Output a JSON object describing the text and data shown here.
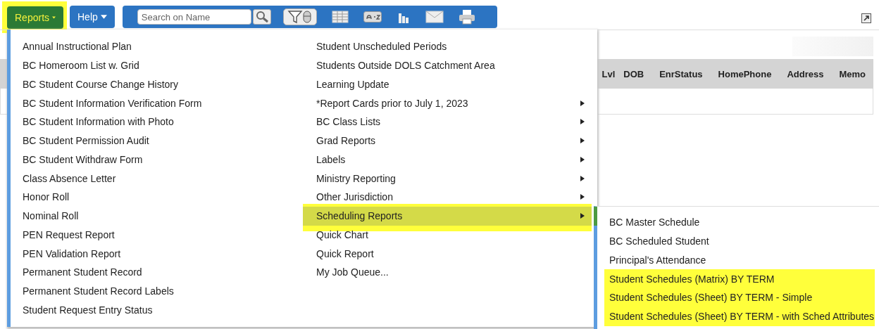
{
  "toolbar": {
    "reports_button": {
      "label": "Reports",
      "highlighted": true
    },
    "help_button": {
      "label": "Help"
    },
    "search": {
      "placeholder": "Search on Name"
    }
  },
  "table": {
    "columns": [
      "Lvl",
      "DOB",
      "EnrStatus",
      "HomePhone",
      "Address",
      "Memo"
    ]
  },
  "reports_menu": {
    "columns": [
      [
        {
          "label": "Annual Instructional Plan",
          "has_submenu": false,
          "selected": false
        },
        {
          "label": "BC Homeroom List w. Grid",
          "has_submenu": false,
          "selected": false
        },
        {
          "label": "BC Student Course Change History",
          "has_submenu": false,
          "selected": false
        },
        {
          "label": "BC Student Information Verification Form",
          "has_submenu": false,
          "selected": false
        },
        {
          "label": "BC Student Information with Photo",
          "has_submenu": false,
          "selected": false
        },
        {
          "label": "BC Student Permission Audit",
          "has_submenu": false,
          "selected": false
        },
        {
          "label": "BC Student Withdraw Form",
          "has_submenu": false,
          "selected": false
        },
        {
          "label": "Class Absence Letter",
          "has_submenu": false,
          "selected": false
        },
        {
          "label": "Honor Roll",
          "has_submenu": false,
          "selected": false
        },
        {
          "label": "Nominal Roll",
          "has_submenu": false,
          "selected": false
        },
        {
          "label": "PEN Request Report",
          "has_submenu": false,
          "selected": false
        },
        {
          "label": "PEN Validation Report",
          "has_submenu": false,
          "selected": false
        },
        {
          "label": "Permanent Student Record",
          "has_submenu": false,
          "selected": false
        },
        {
          "label": "Permanent Student Record Labels",
          "has_submenu": false,
          "selected": false
        },
        {
          "label": "Student Request Entry Status",
          "has_submenu": false,
          "selected": false
        }
      ],
      [
        {
          "label": "Student Unscheduled Periods",
          "has_submenu": false,
          "selected": false
        },
        {
          "label": "Students Outside DOLS Catchment Area",
          "has_submenu": false,
          "selected": false
        },
        {
          "label": "Learning Update",
          "has_submenu": false,
          "selected": false
        },
        {
          "label": "*Report Cards prior to July 1, 2023",
          "has_submenu": true,
          "selected": false
        },
        {
          "label": "BC Class Lists",
          "has_submenu": true,
          "selected": false
        },
        {
          "label": "Grad Reports",
          "has_submenu": true,
          "selected": false
        },
        {
          "label": "Labels",
          "has_submenu": true,
          "selected": false
        },
        {
          "label": "Ministry Reporting",
          "has_submenu": true,
          "selected": false
        },
        {
          "label": "Other Jurisdiction",
          "has_submenu": true,
          "selected": false
        },
        {
          "label": "Scheduling Reports",
          "has_submenu": true,
          "selected": true
        },
        {
          "label": "Quick Chart",
          "has_submenu": false,
          "selected": false
        },
        {
          "label": "Quick Report",
          "has_submenu": false,
          "selected": false
        },
        {
          "label": "My Job Queue...",
          "has_submenu": false,
          "selected": false
        }
      ]
    ]
  },
  "submenu": {
    "items": [
      {
        "label": "BC Master Schedule",
        "highlighted": false
      },
      {
        "label": "BC Scheduled Student",
        "highlighted": false
      },
      {
        "label": "Principal's Attendance",
        "highlighted": false
      },
      {
        "label": "Student Schedules (Matrix) BY TERM",
        "highlighted": true
      },
      {
        "label": "Student Schedules (Sheet) BY TERM - Simple",
        "highlighted": true
      },
      {
        "label": "Student Schedules (Sheet) BY TERM - with Sched Attributes",
        "highlighted": true
      }
    ]
  }
}
